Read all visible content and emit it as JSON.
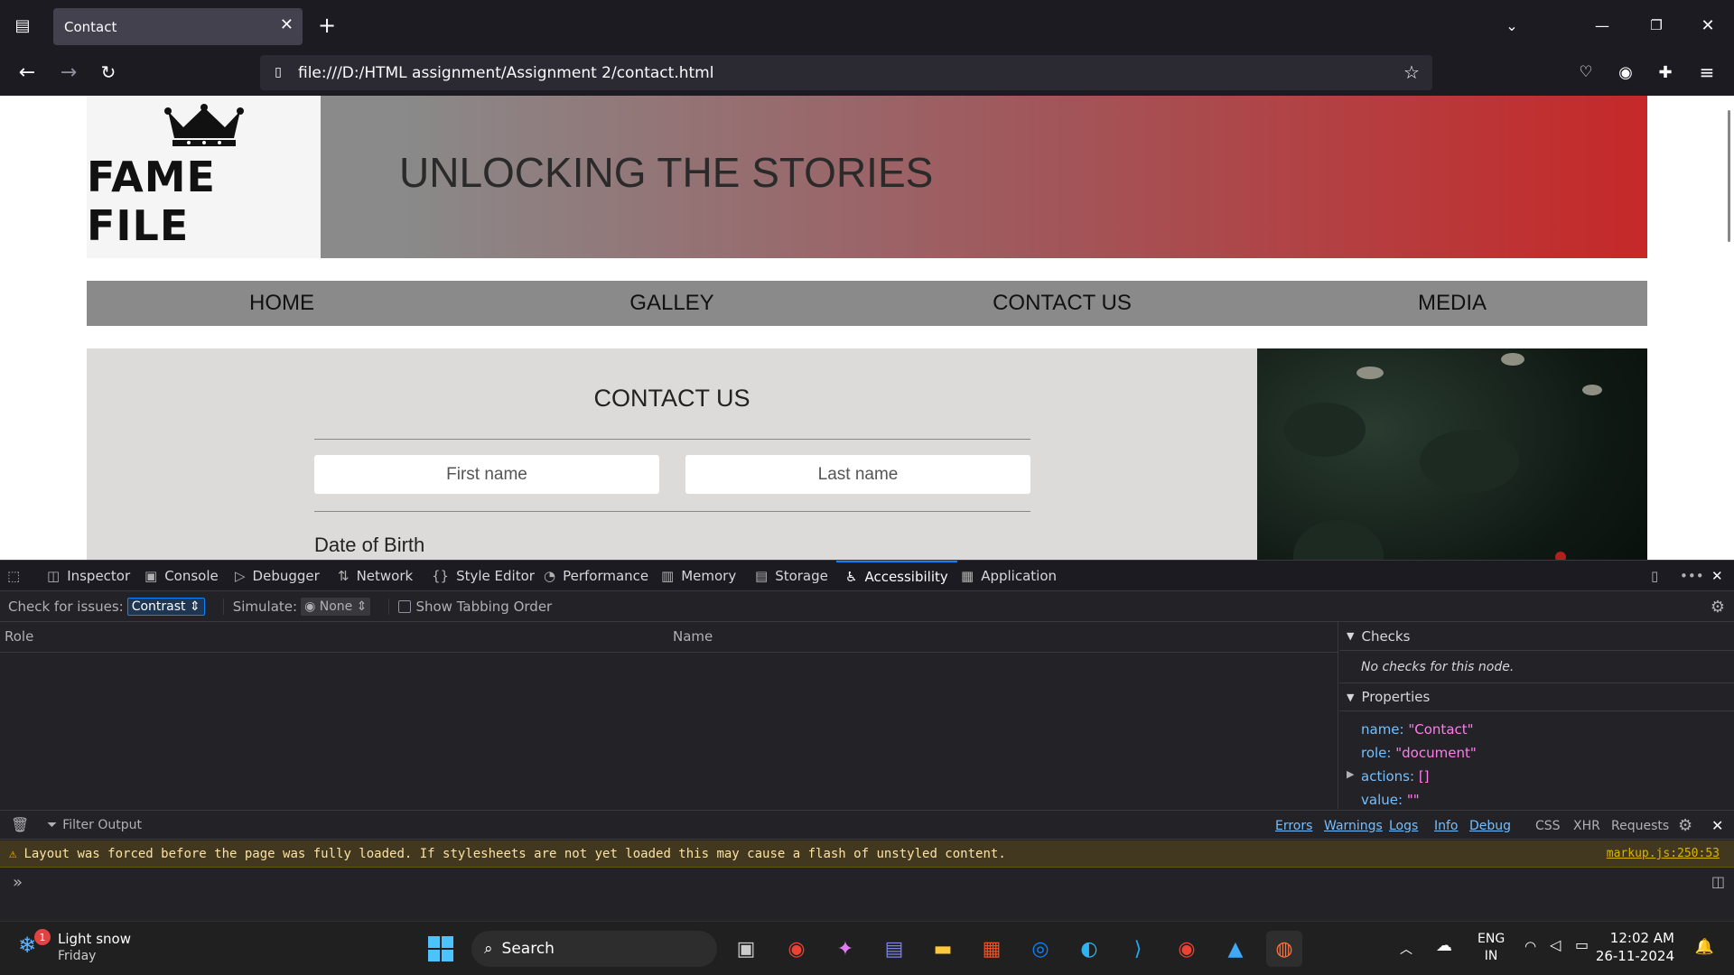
{
  "browser": {
    "tab_title": "Contact",
    "url": "file:///D:/HTML assignment/Assignment 2/contact.html"
  },
  "site": {
    "logo_text": "FAME FILE",
    "tagline": "UNLOCKING THE STORIES",
    "nav": [
      "HOME",
      "GALLEY",
      "CONTACT US",
      "MEDIA"
    ],
    "contact_title": "CONTACT US",
    "first_name_placeholder": "First name",
    "last_name_placeholder": "Last name",
    "dob_label": "Date of Birth"
  },
  "devtools": {
    "tabs": [
      "Inspector",
      "Console",
      "Debugger",
      "Network",
      "Style Editor",
      "Performance",
      "Memory",
      "Storage",
      "Accessibility",
      "Application"
    ],
    "active_tab": "Accessibility",
    "check_label": "Check for issues:",
    "check_value": "Contrast",
    "simulate_label": "Simulate:",
    "simulate_value": "None",
    "tabbing_label": "Show Tabbing Order",
    "col_role": "Role",
    "col_name": "Name",
    "checks_title": "Checks",
    "checks_empty": "No checks for this node.",
    "properties_title": "Properties",
    "properties": [
      {
        "key": "name:",
        "value": "\"Contact\""
      },
      {
        "key": "role:",
        "value": "\"document\""
      },
      {
        "key": "actions:",
        "value": "[]"
      },
      {
        "key": "value:",
        "value": "\"\""
      }
    ]
  },
  "console": {
    "filter_placeholder": "Filter Output",
    "filters": [
      "Errors",
      "Warnings",
      "Logs",
      "Info",
      "Debug"
    ],
    "extras": [
      "CSS",
      "XHR",
      "Requests"
    ],
    "warning": "Layout was forced before the page was fully loaded. If stylesheets are not yet loaded this may cause a flash of unstyled content.",
    "warning_source": "markup.js:250:53"
  },
  "taskbar": {
    "weather_badge": "1",
    "weather": "Light snow",
    "day": "Friday",
    "search_label": "Search",
    "lang": "ENG",
    "region": "IN",
    "time": "12:02 AM",
    "date": "26-11-2024"
  }
}
